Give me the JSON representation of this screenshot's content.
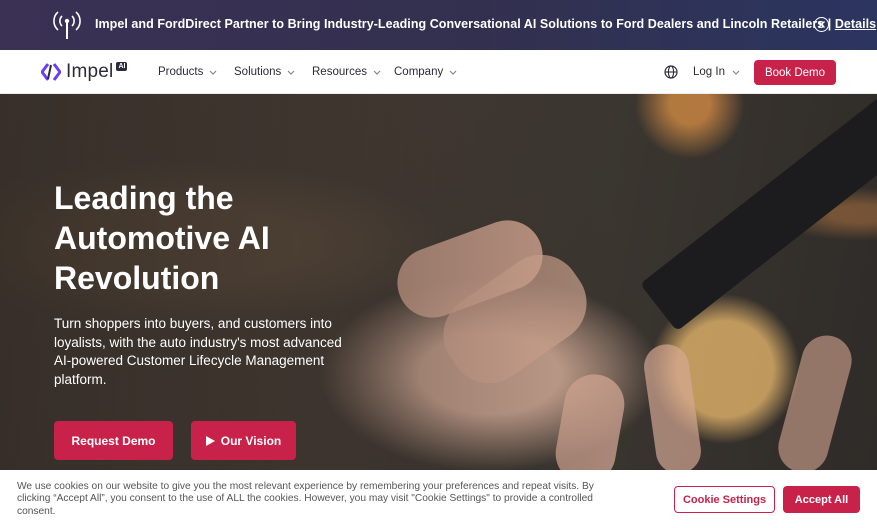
{
  "announcement": {
    "text": "Impel and FordDirect Partner to Bring Industry-Leading Conversational AI Solutions to Ford Dealers and Lincoln Retailers | ",
    "link_label": "Details",
    "icon": "broadcast-antenna-icon",
    "close_icon": "close-circle-icon"
  },
  "nav": {
    "logo_text": "Impel",
    "logo_badge": "AI",
    "menu": [
      {
        "label": "Products"
      },
      {
        "label": "Solutions"
      },
      {
        "label": "Resources"
      },
      {
        "label": "Company"
      }
    ],
    "login_label": "Log In",
    "cta_label": "Book Demo"
  },
  "hero": {
    "title": "Leading the Automotive AI Revolution",
    "subtitle": "Turn shoppers into buyers, and customers into loyalists, with the auto industry's most advanced AI-powered Customer Lifecycle Management platform.",
    "primary_cta": "Request Demo",
    "secondary_cta": "Our Vision"
  },
  "cookie": {
    "text": "We use cookies on our website to give you the most relevant experience by remembering your preferences and repeat visits. By clicking “Accept All”, you consent to the use of ALL the cookies. However, you may visit \"Cookie Settings\" to provide a controlled consent.",
    "settings_label": "Cookie Settings",
    "accept_label": "Accept All"
  },
  "colors": {
    "accent": "#c8224a",
    "announcement_bg": "#33304f",
    "logo_purple": "#6b3ff0"
  }
}
